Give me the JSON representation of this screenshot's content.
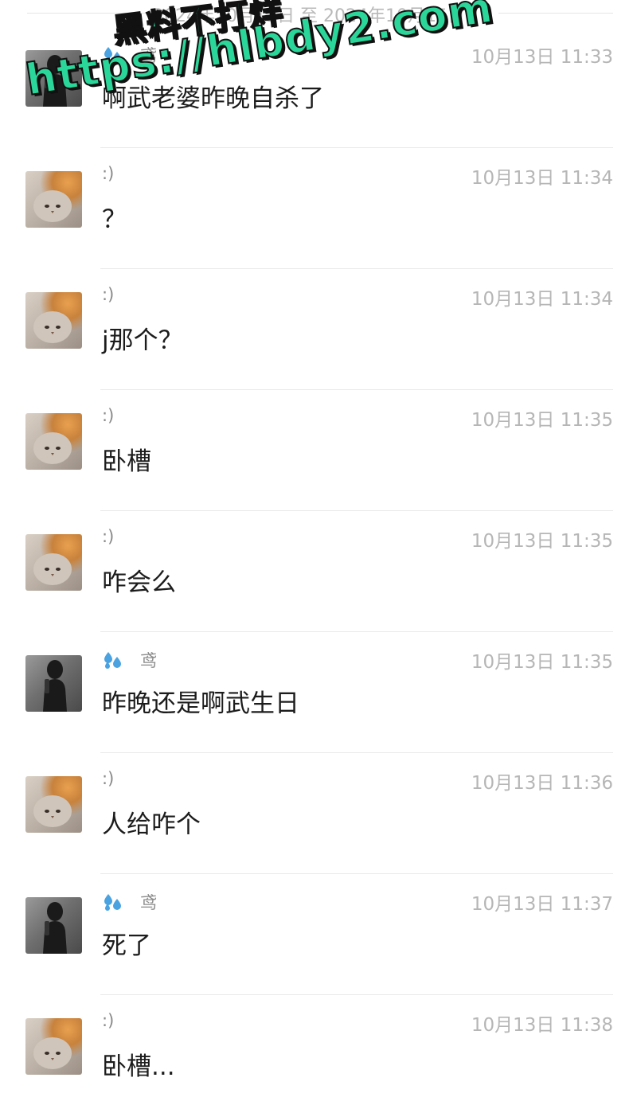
{
  "header": {
    "date_range": "2024年10月13日 至 2024年10月15日"
  },
  "watermark": {
    "line1": "黑料不打烊",
    "line2": "https://hlbdy2.com"
  },
  "messages": [
    {
      "avatar": "person",
      "sender": "鸢",
      "time": "10月13日 11:33",
      "text": "啊武老婆昨晚自杀了"
    },
    {
      "avatar": "cat",
      "sender": ":)",
      "time": "10月13日 11:34",
      "text": "？"
    },
    {
      "avatar": "cat",
      "sender": ":)",
      "time": "10月13日 11:34",
      "text": "j那个？"
    },
    {
      "avatar": "cat",
      "sender": ":)",
      "time": "10月13日 11:35",
      "text": "卧槽"
    },
    {
      "avatar": "cat",
      "sender": ":)",
      "time": "10月13日 11:35",
      "text": "咋会么"
    },
    {
      "avatar": "person",
      "sender": "鸢",
      "time": "10月13日 11:35",
      "text": "昨晚还是啊武生日"
    },
    {
      "avatar": "cat",
      "sender": ":)",
      "time": "10月13日 11:36",
      "text": "人给咋个"
    },
    {
      "avatar": "person",
      "sender": "鸢",
      "time": "10月13日 11:37",
      "text": "死了"
    },
    {
      "avatar": "cat",
      "sender": ":)",
      "time": "10月13日 11:38",
      "text": "卧槽..."
    }
  ],
  "colors": {
    "watermark_fill": "#2bd69a",
    "drops_icon": "#4aa3e0",
    "timestamp": "#b6b6b6"
  }
}
